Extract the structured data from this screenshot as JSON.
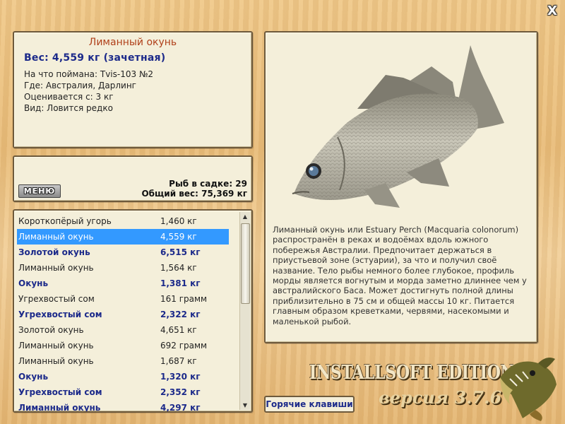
{
  "window": {
    "close_label": "X"
  },
  "info": {
    "title": "Лиманный окунь",
    "weight": "Вес: 4,559 кг (зачетная)",
    "caught_on": "На что поймана: Tvis-103 №2",
    "location": "Где: Австралия, Дарлинг",
    "rated_from": "Оценивается с: 3 кг",
    "rarity": "Вид: Ловится редко"
  },
  "stats": {
    "menu_label": "МЕНЮ",
    "fish_count": "Рыб в садке: 29",
    "total_weight": "Общий вес: 75,369 кг"
  },
  "catch_list": [
    {
      "name": "Короткопёрый угорь",
      "weight": "1,460 кг",
      "style": "normal"
    },
    {
      "name": "Лиманный окунь",
      "weight": "4,559 кг",
      "style": "selected"
    },
    {
      "name": "Золотой окунь",
      "weight": "6,515 кг",
      "style": "bold"
    },
    {
      "name": "Лиманный окунь",
      "weight": "1,564 кг",
      "style": "normal"
    },
    {
      "name": "Окунь",
      "weight": "1,381 кг",
      "style": "bold"
    },
    {
      "name": "Угрехвостый сом",
      "weight": "161 грамм",
      "style": "normal"
    },
    {
      "name": "Угрехвостый сом",
      "weight": "2,322 кг",
      "style": "bold"
    },
    {
      "name": "Золотой окунь",
      "weight": "4,651 кг",
      "style": "normal"
    },
    {
      "name": "Лиманный окунь",
      "weight": "692 грамм",
      "style": "normal"
    },
    {
      "name": "Лиманный окунь",
      "weight": "1,687 кг",
      "style": "normal"
    },
    {
      "name": "Окунь",
      "weight": "1,320 кг",
      "style": "bold"
    },
    {
      "name": "Угрехвостый сом",
      "weight": "2,352 кг",
      "style": "bold"
    },
    {
      "name": "Лиманный окунь",
      "weight": "4,297 кг",
      "style": "bold"
    }
  ],
  "description": "Лиманный окунь или Estuary Perch (Macquaria colonorum) распространён в реках и водоёмах вдоль южного побережья Австралии. Предпочитает держаться в приустьевой зоне (эстуарии), за что и получил своё название. Тело рыбы немного более глубокое, профиль морды является вогнутым и морда заметно длиннее чем у австралийского Баса. Может достигнуть полной длины приблизительно в 75 см и общей массы 10 кг. Питается главным образом креветками, червями, насекомыми и маленькой рыбой.",
  "hotkeys_label": "Горячие клавиши",
  "branding": {
    "edition": "INSTALLSOFT EDITION",
    "version": "версия 3.7.6"
  },
  "icons": {
    "logo": "pike-logo-icon",
    "fish_image": "estuary-perch-image"
  }
}
